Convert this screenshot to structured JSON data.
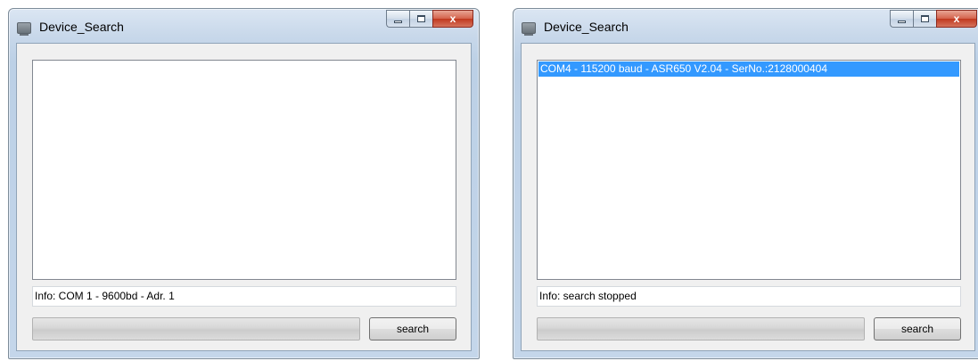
{
  "windows": [
    {
      "title": "Device_Search",
      "list_items": [],
      "info_text": "Info: COM 1 - 9600bd - Adr. 1",
      "progress": 0,
      "search_label": "search",
      "caption": {
        "minimize": "minimize-icon",
        "maximize": "maximize-icon",
        "close": "close-icon",
        "close_glyph": "x"
      }
    },
    {
      "title": "Device_Search",
      "list_items": [
        "COM4 - 115200 baud - ASR650 V2.04 - SerNo.:2128000404"
      ],
      "selected_index": 0,
      "info_text": "Info: search stopped",
      "progress": 0,
      "search_label": "search",
      "caption": {
        "minimize": "minimize-icon",
        "maximize": "maximize-icon",
        "close": "close-icon",
        "close_glyph": "x"
      }
    }
  ],
  "colors": {
    "selection": "#3399ff",
    "close_button": "#c1381f",
    "titlebar": "#c8d8ea"
  }
}
